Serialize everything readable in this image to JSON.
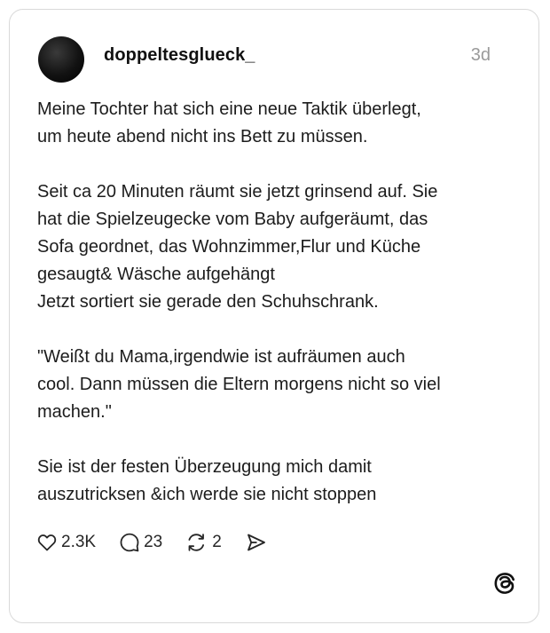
{
  "post": {
    "username": "doppeltesglueck_",
    "timestamp": "3d",
    "paragraphs": [
      "Meine Tochter hat sich eine neue Taktik überlegt,\num heute abend nicht ins Bett zu müssen.",
      "Seit ca 20 Minuten räumt sie jetzt grinsend auf. Sie\nhat die Spielzeugecke vom Baby aufgeräumt, das\nSofa geordnet, das Wohnzimmer,Flur und Küche\ngesaugt& Wäsche aufgehängt\nJetzt sortiert sie gerade den Schuhschrank.",
      "\"Weißt du Mama,irgendwie ist aufräumen auch\ncool. Dann müssen die Eltern morgens nicht so viel\nmachen.\"",
      "Sie ist der festen Überzeugung mich damit\nauszutricksen &ich werde sie nicht stoppen"
    ],
    "likes": "2.3K",
    "replies": "23",
    "reposts": "2"
  },
  "icons": {
    "like": "heart-icon",
    "reply": "speech-bubble-icon",
    "repost": "repost-arrows-icon",
    "share": "send-icon",
    "brand": "threads-logo-icon"
  },
  "colors": {
    "text": "#1c1c1c",
    "muted": "#9a9a9a",
    "border": "#d9d9d9"
  }
}
